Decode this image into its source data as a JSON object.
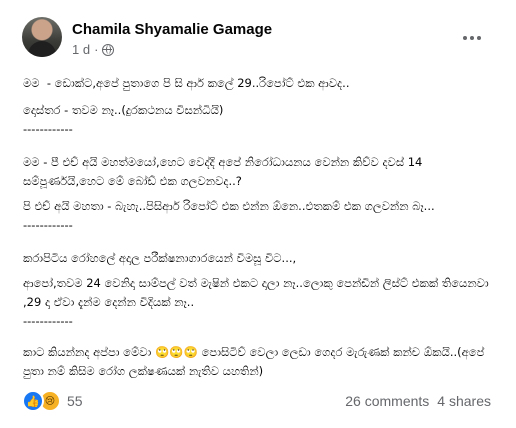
{
  "post": {
    "author": "Chamila Shyamalie Gamage",
    "time": "1 d",
    "dot": "·",
    "privacy_icon": "globe-icon",
    "more_icon": "more-horizontal-icon",
    "paragraphs": [
      "මම  - ඩොක්ට,අපේ පුතාගෙ පි සි ආර් කලේ 29..රිපෝට් එක ආවද..",
      "දොස්තර - තවම නෑ..(දුරකථනය විසන්ධියි)",
      "------------",
      "මම - පී එච් අයි මහත්මයෝ,හෙට වෙද්දි අපේ නිරෝධායනය වෙන්න කිව්ව දවස් 14 සම්පූර්ණයි,හෙට මේ බෝඩ් එක ගලවනවද..?",
      "පි එච් අයි මහතා - බැහැ..පිසිආර් රිපෝට් එක එන්න ඕනෙ..එතකම් එක ගලවන්න බෑ...",
      "------------",
      "කරාපිටිය රෝහලේ අදාල පරීක්ෂනාගාරයෙන් විමසූ විට...,",
      "ආපෝ,තවම 24 වෙනිදා සාම්පල් වත් මැෂින් එකට දාලා නෑ..ලොකු පෙන්ඩින් ලිස්ට් එකක් තියෙනවා ,29 දා ඒවා දැන්ම දෙන්න විදියක් නෑ..",
      "------------",
      "කාට කියන්නද අප්පා මේවා 🙄🙄🙄 පොසිටිව් වෙලා ලෙඩා ගෙදර මැරුණක් කන්ච ඕකයි..(අපේ පුතා නම් කිසිම රෝග ලක්ෂණයක් නැතිව යහතින්)"
    ]
  },
  "footer": {
    "reaction_icons": [
      "like-icon",
      "sad-icon"
    ],
    "reaction_count": "55",
    "comments": "26 comments",
    "shares": "4 shares"
  }
}
